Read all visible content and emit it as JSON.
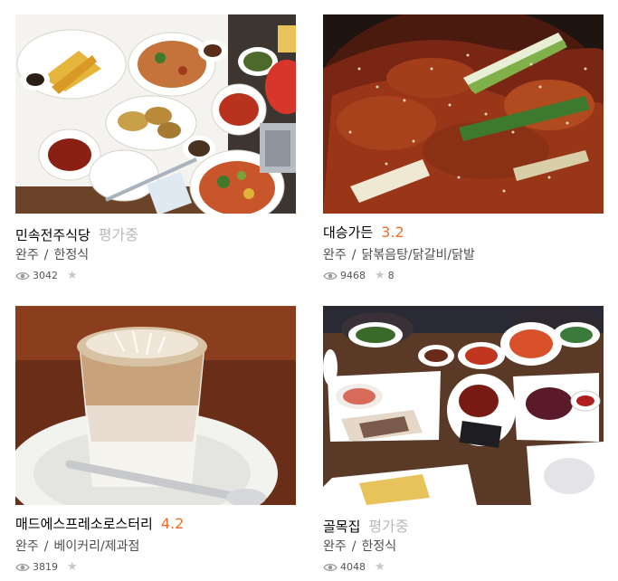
{
  "restaurants": [
    {
      "name": "민속전주식당",
      "rating": "평가중",
      "region": "완주",
      "separator": "/",
      "category": "한정식",
      "views": "3042",
      "reviews": "",
      "image": "korean-table-dishes-with-pancakes"
    },
    {
      "name": "대승가든",
      "rating": "3.2",
      "region": "완주",
      "separator": "/",
      "category": "닭볶음탕/닭갈비/닭발",
      "views": "9468",
      "reviews": "8",
      "image": "spicy-chicken-with-green-onion"
    },
    {
      "name": "매드에스프레소로스터리",
      "rating": "4.2",
      "region": "완주",
      "separator": "/",
      "category": "베이커리/제과점",
      "views": "3819",
      "reviews": "",
      "image": "iced-coffee-latte-glass"
    },
    {
      "name": "골목집",
      "rating": "평가중",
      "region": "완주",
      "separator": "/",
      "category": "한정식",
      "views": "4048",
      "reviews": "",
      "image": "boiled-pork-and-side-dishes"
    }
  ],
  "colors": {
    "rating_scored": "#f26b2a",
    "rating_pending": "#b9b9b9",
    "icon_gray": "#c7c7c7"
  },
  "icons": {
    "views": "eye-icon",
    "reviews": "star-icon"
  }
}
